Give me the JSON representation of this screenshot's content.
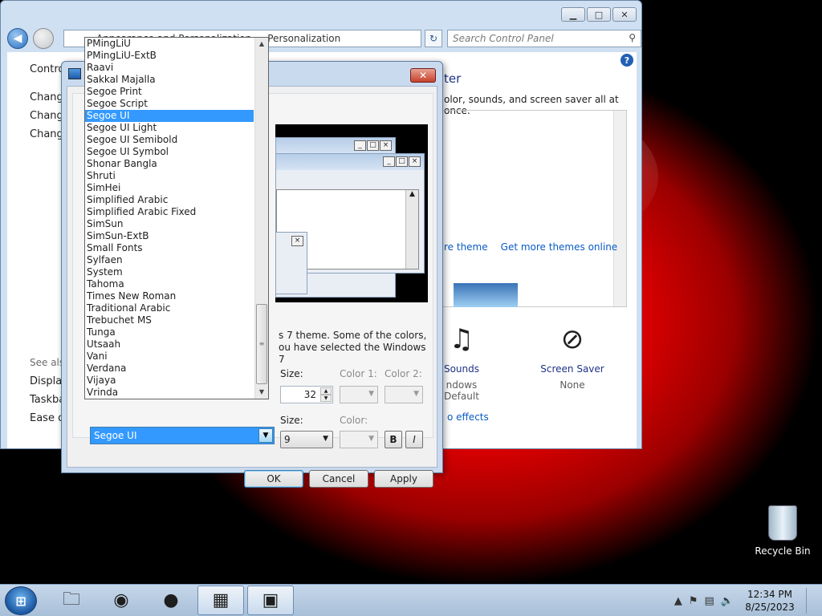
{
  "control_panel": {
    "address_parts": [
      "Appearance and Personalization",
      "Personalization"
    ],
    "address_separator": "▸",
    "search_placeholder": "Search Control Panel",
    "left_items": [
      "Contro",
      "Change",
      "Change",
      "Change"
    ],
    "heading": "ter",
    "description": "olor, sounds, and screen saver all at once.",
    "theme_links": [
      "re theme",
      "Get more themes online"
    ],
    "see_also_head": "See also",
    "see_also_items": [
      "Display",
      "Taskba",
      "Ease of"
    ],
    "sounds": {
      "label": "Sounds",
      "sub": "ndows Default"
    },
    "screen_saver": {
      "label": "Screen Saver",
      "sub": "None"
    },
    "effects_link": "o effects"
  },
  "dialog": {
    "tab_stub": "W",
    "description": "s 7 theme.  Some of the colors, ou have selected the Windows 7",
    "size_label": "Size:",
    "size_value": "32",
    "color1_label": "Color 1:",
    "color2_label": "Color 2:",
    "size2_label": "Size:",
    "size2_value": "9",
    "color_label": "Color:",
    "bold_label": "B",
    "italic_label": "I",
    "font_value": "Segoe UI",
    "ok_label": "OK",
    "cancel_label": "Cancel",
    "apply_label": "Apply"
  },
  "font_list": {
    "items": [
      "PMingLiU",
      "PMingLiU-ExtB",
      "Raavi",
      "Sakkal Majalla",
      "Segoe Print",
      "Segoe Script",
      "Segoe UI",
      "Segoe UI Light",
      "Segoe UI Semibold",
      "Segoe UI Symbol",
      "Shonar Bangla",
      "Shruti",
      "SimHei",
      "Simplified Arabic",
      "Simplified Arabic Fixed",
      "SimSun",
      "SimSun-ExtB",
      "Small Fonts",
      "Sylfaen",
      "System",
      "Tahoma",
      "Times New Roman",
      "Traditional Arabic",
      "Trebuchet MS",
      "Tunga",
      "Utsaah",
      "Vani",
      "Verdana",
      "Vijaya",
      "Vrinda"
    ],
    "selected": "Segoe UI"
  },
  "desktop": {
    "recycle_bin_label": "Recycle Bin"
  },
  "taskbar": {
    "clock_time": "12:34 PM",
    "clock_date": "8/25/2023",
    "tray_up_arrow": "▲"
  },
  "colors": {
    "selection": "#3399ff",
    "link": "#0a5bc4",
    "heading": "#1e3287"
  }
}
